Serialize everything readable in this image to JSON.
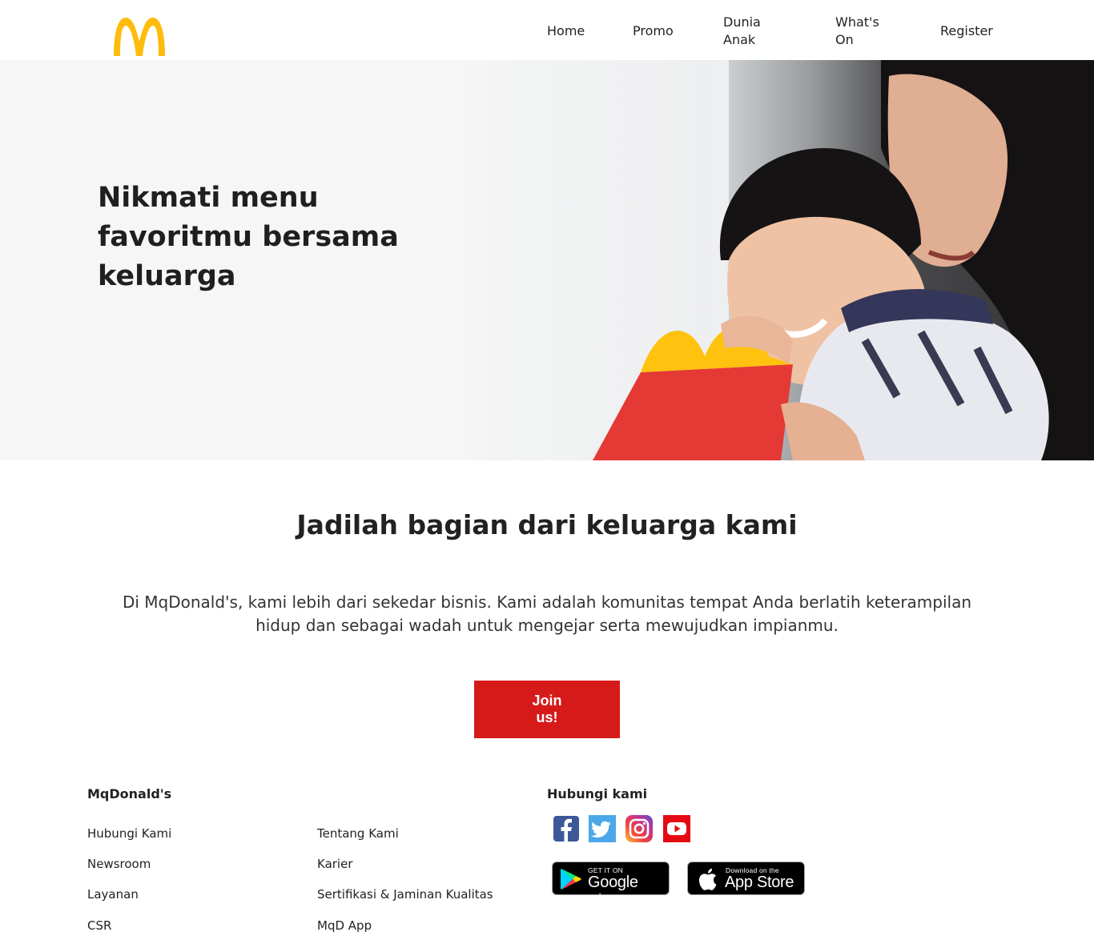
{
  "header": {
    "logo_alt": "McDonald's Golden Arches",
    "nav": {
      "home": "Home",
      "promo": "Promo",
      "dunia_anak": "Dunia Anak",
      "whats_on": "What's On",
      "register": "Register"
    }
  },
  "hero": {
    "title": "Nikmati menu favoritmu bersama keluarga"
  },
  "family": {
    "title": "Jadilah bagian dari keluarga kami",
    "description": "Di MqDonald's, kami lebih dari sekedar bisnis. Kami adalah komunitas tempat Anda berlatih keterampilan hidup dan sebagai wadah untuk mengejar serta mewujudkan impianmu.",
    "join_button": "Join us!"
  },
  "footer": {
    "brand_heading": "MqDonald's",
    "links_col1": [
      "Hubungi Kami",
      "Newsroom",
      "Layanan",
      "CSR"
    ],
    "links_col2": [
      "Tentang Kami",
      "Karier",
      "Sertifikasi & Jaminan Kualitas",
      "MqD App"
    ],
    "contact_heading": "Hubungi kami",
    "social_icons": [
      "facebook-icon",
      "twitter-icon",
      "instagram-icon",
      "youtube-icon"
    ],
    "google_play": {
      "small": "GET IT ON",
      "big": "Google Play"
    },
    "app_store": {
      "small": "Download on the",
      "big": "App Store"
    }
  },
  "colors": {
    "brand_red": "#d61a1a",
    "arches_yellow": "#ffbc0d",
    "text_dark": "#222222"
  }
}
